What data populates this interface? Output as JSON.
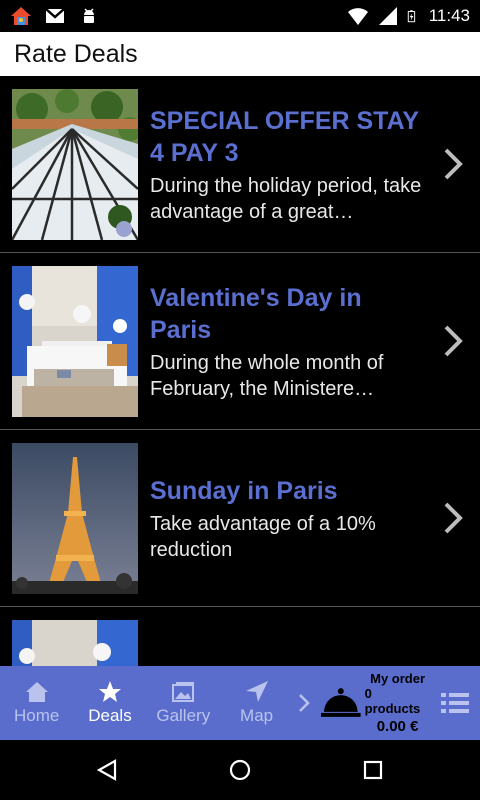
{
  "status_bar": {
    "time": "11:43",
    "icons": [
      "home-app-icon",
      "gmail-icon",
      "android-debug-icon",
      "wifi-icon",
      "signal-icon",
      "battery-charging-icon"
    ]
  },
  "title": "Rate Deals",
  "deals": [
    {
      "title": "SPECIAL OFFER STAY 4 PAY 3",
      "description": "During the holiday period, take advantage of a great…",
      "image": "glass-roof-garden-photo"
    },
    {
      "title": "Valentine's Day in Paris",
      "description": "During the whole month of February, the Ministere…",
      "image": "hotel-room-photo"
    },
    {
      "title": "Sunday in Paris",
      "description": "Take advantage of a 10% reduction",
      "image": "eiffel-tower-night-photo"
    }
  ],
  "tabs": [
    {
      "label": "Home",
      "icon": "home-icon",
      "active": false
    },
    {
      "label": "Deals",
      "icon": "star-icon",
      "active": true
    },
    {
      "label": "Gallery",
      "icon": "gallery-icon",
      "active": false
    },
    {
      "label": "Map",
      "icon": "navigation-arrow-icon",
      "active": false
    }
  ],
  "order": {
    "title": "My order",
    "count": "0 products",
    "total": "0.00 €"
  },
  "colors": {
    "accent": "#5a6dcc",
    "deal_title": "#5b6fd0",
    "tab_inactive": "#b9c3ee"
  }
}
